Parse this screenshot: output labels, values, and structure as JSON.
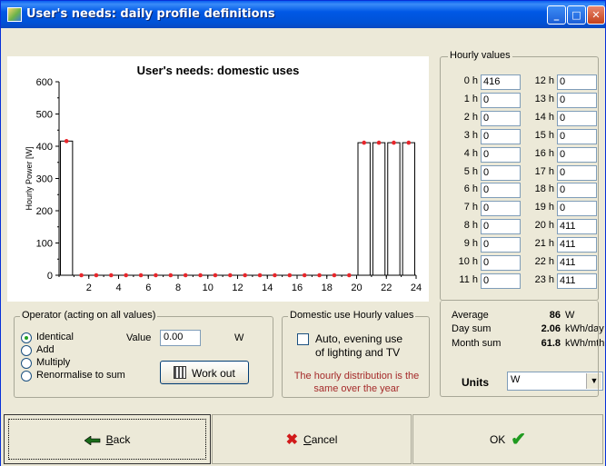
{
  "window": {
    "title": "User's needs: daily profile definitions"
  },
  "chart_data": {
    "type": "bar",
    "title": "User's needs: domestic uses",
    "ylabel": "Hourly Power [W]",
    "xlabel": "",
    "x": [
      0,
      1,
      2,
      3,
      4,
      5,
      6,
      7,
      8,
      9,
      10,
      11,
      12,
      13,
      14,
      15,
      16,
      17,
      18,
      19,
      20,
      21,
      22,
      23
    ],
    "values": [
      416,
      0,
      0,
      0,
      0,
      0,
      0,
      0,
      0,
      0,
      0,
      0,
      0,
      0,
      0,
      0,
      0,
      0,
      0,
      0,
      411,
      411,
      411,
      411
    ],
    "ylim": [
      0,
      600
    ],
    "xlim": [
      0,
      24
    ],
    "yticks": [
      "0",
      "100",
      "200",
      "300",
      "400",
      "500",
      "600"
    ],
    "xticks": [
      "2",
      "4",
      "6",
      "8",
      "10",
      "12",
      "14",
      "16",
      "18",
      "20",
      "22",
      "24"
    ],
    "bar_color": "#ffffff",
    "marker_color": "#e8262b"
  },
  "hourly": {
    "label": "Hourly values",
    "left": [
      {
        "h": "0 h",
        "v": "416"
      },
      {
        "h": "1 h",
        "v": "0"
      },
      {
        "h": "2 h",
        "v": "0"
      },
      {
        "h": "3 h",
        "v": "0"
      },
      {
        "h": "4 h",
        "v": "0"
      },
      {
        "h": "5 h",
        "v": "0"
      },
      {
        "h": "6 h",
        "v": "0"
      },
      {
        "h": "7 h",
        "v": "0"
      },
      {
        "h": "8 h",
        "v": "0"
      },
      {
        "h": "9 h",
        "v": "0"
      },
      {
        "h": "10 h",
        "v": "0"
      },
      {
        "h": "11 h",
        "v": "0"
      }
    ],
    "right": [
      {
        "h": "12 h",
        "v": "0"
      },
      {
        "h": "13 h",
        "v": "0"
      },
      {
        "h": "14 h",
        "v": "0"
      },
      {
        "h": "15 h",
        "v": "0"
      },
      {
        "h": "16 h",
        "v": "0"
      },
      {
        "h": "17 h",
        "v": "0"
      },
      {
        "h": "18 h",
        "v": "0"
      },
      {
        "h": "19 h",
        "v": "0"
      },
      {
        "h": "20 h",
        "v": "411"
      },
      {
        "h": "21 h",
        "v": "411"
      },
      {
        "h": "22 h",
        "v": "411"
      },
      {
        "h": "23 h",
        "v": "411"
      }
    ]
  },
  "summary": {
    "average_label": "Average",
    "average_value": "86",
    "average_unit": "W",
    "daysum_label": "Day sum",
    "daysum_value": "2.06",
    "daysum_unit": "kWh/day",
    "monthsum_label": "Month sum",
    "monthsum_value": "61.8",
    "monthsum_unit": "kWh/mth"
  },
  "units": {
    "label": "Units",
    "value": "W"
  },
  "operator": {
    "label": "Operator  (acting on all values)",
    "options": [
      "Identical",
      "Add",
      "Multiply",
      "Renormalise to sum"
    ],
    "selected": "Identical",
    "value_label": "Value",
    "value": "0.00",
    "value_unit": "W",
    "work_out_label": "Work out"
  },
  "domestic": {
    "label": "Domestic use Hourly values",
    "auto_line1": "Auto, evening use",
    "auto_line2": "of lighting and TV",
    "auto_checked": false,
    "note_line1": "The hourly distribution is the",
    "note_line2": "same over the year",
    "note_color": "#a52a2a"
  },
  "buttons": {
    "back_first": "B",
    "back_rest": "ack",
    "cancel_first": "C",
    "cancel_rest": "ancel",
    "ok": "OK"
  }
}
